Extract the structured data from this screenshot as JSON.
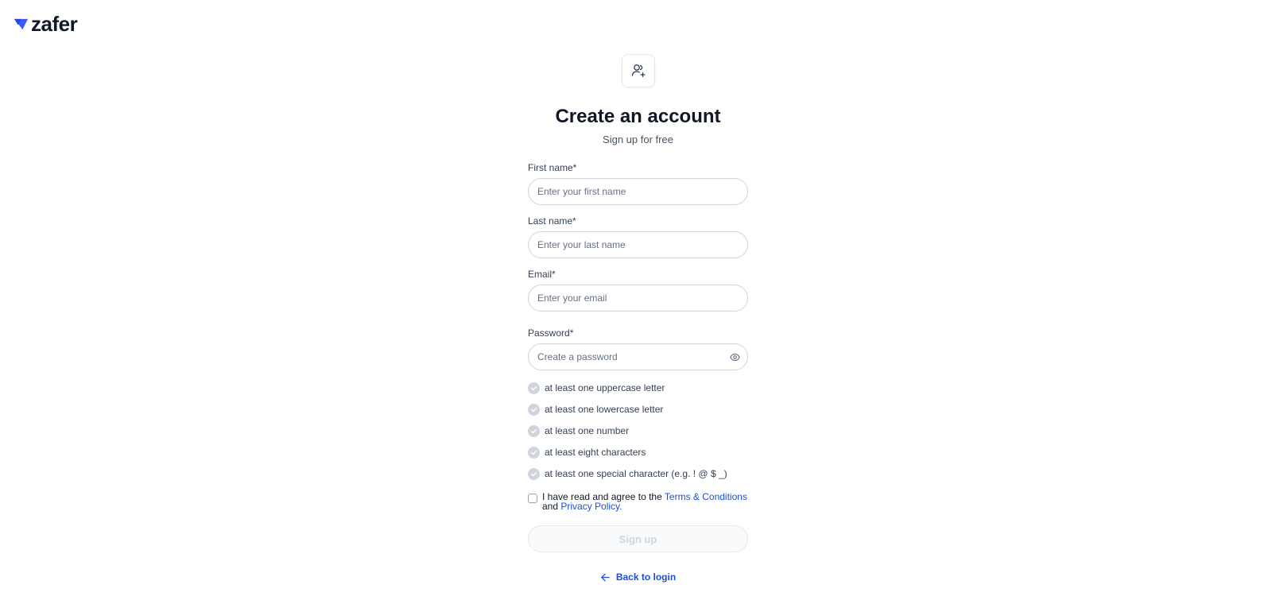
{
  "brand": {
    "name": "zafer",
    "accent": "#3b5bff"
  },
  "icons": {
    "header": "user-plus-icon",
    "password_toggle": "eye-icon",
    "requirement": "check-circle-icon",
    "back": "arrow-left-icon"
  },
  "header": {
    "title": "Create an account",
    "subtitle": "Sign up for free"
  },
  "form": {
    "first_name": {
      "label": "First name*",
      "placeholder": "Enter your first name",
      "value": ""
    },
    "last_name": {
      "label": "Last name*",
      "placeholder": "Enter your last name",
      "value": ""
    },
    "email": {
      "label": "Email*",
      "placeholder": "Enter your email",
      "value": ""
    },
    "password": {
      "label": "Password*",
      "placeholder": "Create a password",
      "value": ""
    }
  },
  "requirements": [
    "at least one uppercase letter",
    "at least one lowercase letter",
    "at least one number",
    "at least eight characters",
    "at least one special character (e.g. ! @ $ _)"
  ],
  "terms": {
    "prefix": "I have read and agree to the ",
    "terms_link": "Terms & Conditions",
    "middle": "and ",
    "privacy_link": "Privacy Policy."
  },
  "signup_label": "Sign up",
  "back_label": "Back to login",
  "colors": {
    "link": "#1d4ed8",
    "disabled_text": "#d0d5dd",
    "check_inactive": "#d0d5dd"
  }
}
